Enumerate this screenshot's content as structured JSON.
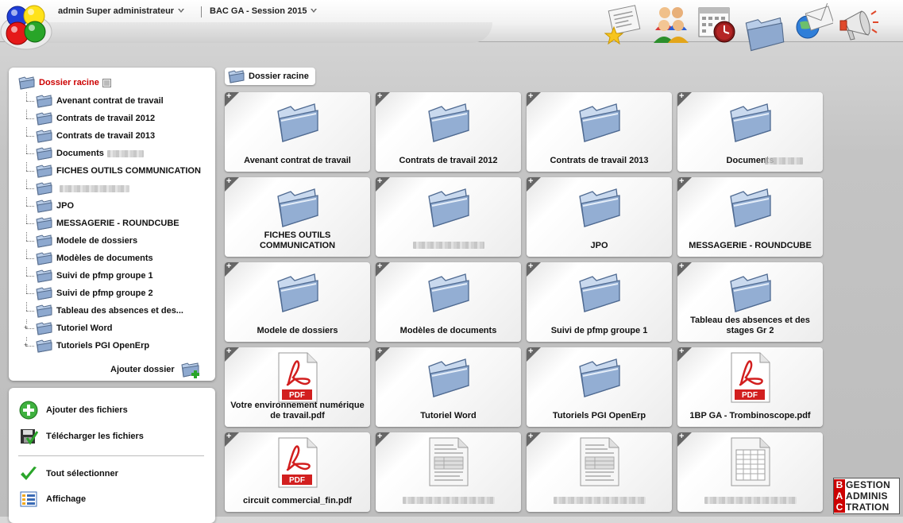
{
  "header": {
    "user_label": "admin Super administrateur",
    "session_label": "BAC GA - Session 2015",
    "icons": [
      "news-icon",
      "users-icon",
      "calendar-icon",
      "folder-icon",
      "mail-icon",
      "megaphone-icon"
    ]
  },
  "tree": {
    "root_label": "Dossier racine",
    "items": [
      {
        "label": "Avenant contrat de travail"
      },
      {
        "label": "Contrats de travail 2012"
      },
      {
        "label": "Contrats de travail 2013"
      },
      {
        "label": "Documents"
      },
      {
        "label": "FICHES OUTILS COMMUNICATION"
      },
      {
        "label": ""
      },
      {
        "label": "JPO"
      },
      {
        "label": "MESSAGERIE - ROUNDCUBE"
      },
      {
        "label": "Modele de dossiers"
      },
      {
        "label": "Modèles de documents"
      },
      {
        "label": "Suivi de pfmp groupe 1"
      },
      {
        "label": "Suivi de pfmp groupe 2"
      },
      {
        "label": "Tableau des absences et des..."
      },
      {
        "label": "Tutoriel Word"
      },
      {
        "label": "Tutoriels PGI OpenErp"
      }
    ],
    "add_folder_label": "Ajouter dossier"
  },
  "actions": {
    "add_files": "Ajouter des fichiers",
    "download_files": "Télécharger les fichiers",
    "select_all": "Tout sélectionner",
    "display": "Affichage"
  },
  "breadcrumb": {
    "label": "Dossier racine"
  },
  "tiles": [
    {
      "type": "folder",
      "name": "Avenant contrat de travail"
    },
    {
      "type": "folder",
      "name": "Contrats de travail 2012"
    },
    {
      "type": "folder",
      "name": "Contrats de travail 2013"
    },
    {
      "type": "folder",
      "name": "Documents"
    },
    {
      "type": "folder",
      "name": "FICHES OUTILS COMMUNICATION"
    },
    {
      "type": "folder",
      "name": ""
    },
    {
      "type": "folder",
      "name": "JPO"
    },
    {
      "type": "folder",
      "name": "MESSAGERIE - ROUNDCUBE"
    },
    {
      "type": "folder",
      "name": "Modele de dossiers"
    },
    {
      "type": "folder",
      "name": "Modèles de documents"
    },
    {
      "type": "folder",
      "name": "Suivi de pfmp groupe 1"
    },
    {
      "type": "folder",
      "name": "Tableau des absences et des stages Gr 2"
    },
    {
      "type": "pdf",
      "name": "Votre environnement numérique de travail.pdf"
    },
    {
      "type": "folder",
      "name": "Tutoriel Word"
    },
    {
      "type": "folder",
      "name": "Tutoriels PGI OpenErp"
    },
    {
      "type": "pdf",
      "name": "1BP GA - Trombinoscope.pdf"
    },
    {
      "type": "pdf",
      "name": "circuit commercial_fin.pdf"
    },
    {
      "type": "doc",
      "name": ""
    },
    {
      "type": "doc",
      "name": ""
    },
    {
      "type": "sheet",
      "name": ""
    }
  ],
  "tile_plus": "+",
  "pdf_label": "PDF",
  "brand": {
    "rows": [
      {
        "letter": "B",
        "rest": "GESTION"
      },
      {
        "letter": "A",
        "rest": "ADMINIS"
      },
      {
        "letter": "C",
        "rest": "TRATION"
      }
    ]
  }
}
